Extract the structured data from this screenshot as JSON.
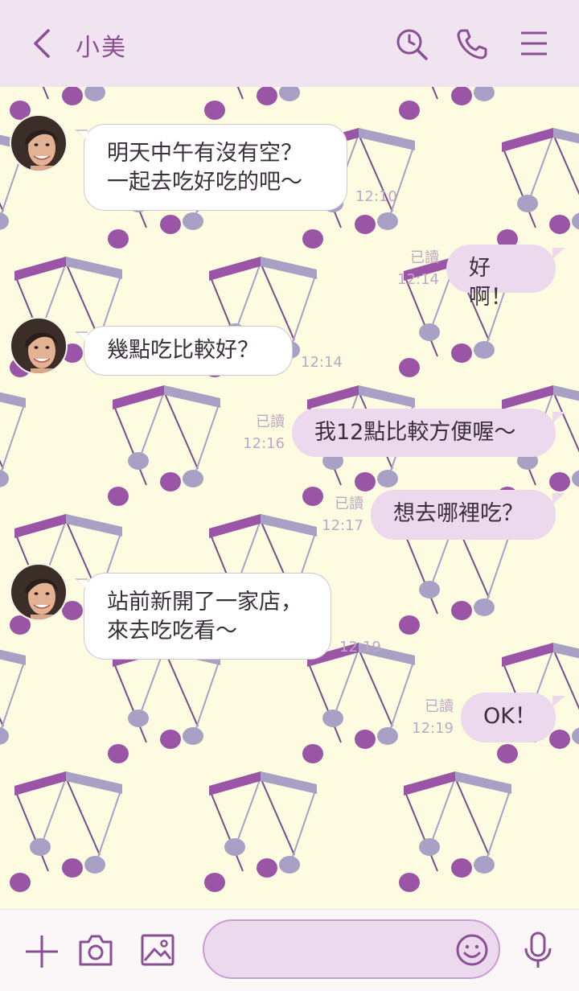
{
  "header": {
    "contact_name": "小美",
    "icons": [
      "back-chevron-icon",
      "search-history-icon",
      "phone-icon",
      "menu-icon"
    ]
  },
  "theme": {
    "header_bg": "#f1e4f1",
    "accent": "#8a4f95",
    "chat_bg": "#fdfce0",
    "incoming_bubble": "#ffffff",
    "outgoing_bubble": "#ecd9ee",
    "meta_text": "#c2a6c6"
  },
  "messages": [
    {
      "direction": "in",
      "text": "明天中午有沒有空？\n一起去吃好吃的吧～",
      "time": "12:10"
    },
    {
      "direction": "out",
      "text": "好啊！",
      "read": "已讀",
      "time": "12:14"
    },
    {
      "direction": "in",
      "text": "幾點吃比較好？",
      "time": "12:14"
    },
    {
      "direction": "out",
      "text": "我12點比較方便喔～",
      "read": "已讀",
      "time": "12:16"
    },
    {
      "direction": "out",
      "text": "想去哪裡吃？",
      "read": "已讀",
      "time": "12:17"
    },
    {
      "direction": "in",
      "text": "站前新開了一家店，\n來去吃吃看～",
      "time": "12:19"
    },
    {
      "direction": "out",
      "text": "OK！",
      "read": "已讀",
      "time": "12:19"
    }
  ],
  "input_bar": {
    "message_value": "",
    "icons": [
      "plus-icon",
      "camera-icon",
      "image-icon",
      "emoji-icon",
      "microphone-icon"
    ]
  }
}
